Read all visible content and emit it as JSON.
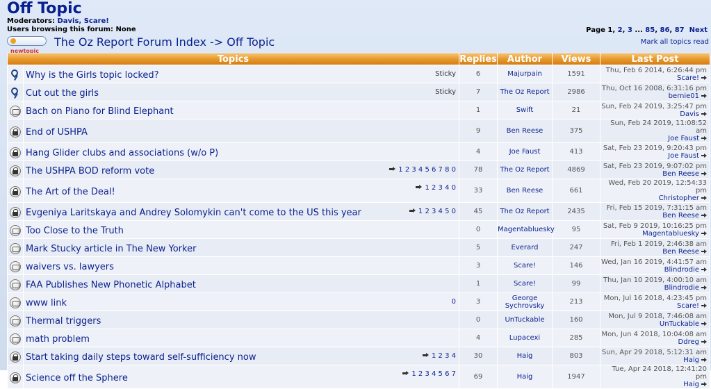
{
  "forum": {
    "title": "Off Topic",
    "moderators_label": "Moderators:",
    "moderators": "Davis, Scare!",
    "browsing": "Users browsing this forum: None",
    "new_topic_label": "newtopic",
    "breadcrumb": "The Oz Report Forum Index -> Off Topic"
  },
  "pagination": {
    "label": "Page",
    "current": "1",
    "sep1": ",",
    "p2": "2",
    "sep2": ",",
    "p3": "3",
    "ellipsis": "...",
    "p85": "85",
    "sep3": ",",
    "p86": "86",
    "sep4": ",",
    "p87": "87",
    "next": "Next",
    "mark_all": "Mark all topics read"
  },
  "columns": {
    "topics": "Topics",
    "replies": "Replies",
    "author": "Author",
    "views": "Views",
    "last_post": "Last Post"
  },
  "topics": [
    {
      "icon": "pin-icon",
      "title": "Why is the Girls topic locked?",
      "tag": "Sticky",
      "pages": "",
      "replies": "6",
      "author": "Majurpain",
      "views": "1591",
      "last_date": "Thu, Feb 6 2014, 6:26:44 pm",
      "last_user": "Scare!"
    },
    {
      "icon": "pin-icon",
      "title": "Cut out the girls",
      "tag": "Sticky",
      "pages": "",
      "replies": "7",
      "author": "The Oz Report",
      "views": "2986",
      "last_date": "Thu, Oct 16 2008, 6:31:16 pm",
      "last_user": "bernie01"
    },
    {
      "icon": "topic-icon",
      "title": "Bach on Piano for Blind Elephant",
      "tag": "",
      "pages": "",
      "replies": "1",
      "author": "Swift",
      "views": "21",
      "last_date": "Sun, Feb 24 2019, 3:25:47 pm",
      "last_user": "Davis"
    },
    {
      "icon": "lock-icon",
      "title": "End of USHPA",
      "tag": "",
      "pages": "",
      "replies": "9",
      "author": "Ben Reese",
      "views": "375",
      "last_date": "Sun, Feb 24 2019, 11:08:52 am",
      "last_user": "Joe Faust"
    },
    {
      "icon": "lock-icon",
      "title": "Hang Glider clubs and associations (w/o P)",
      "tag": "",
      "pages": "",
      "replies": "4",
      "author": "Joe Faust",
      "views": "413",
      "last_date": "Sat, Feb 23 2019, 9:20:43 pm",
      "last_user": "Joe Faust"
    },
    {
      "icon": "lock-icon",
      "title": "The USHPA BOD reform vote",
      "tag": "",
      "pages": "1 2 3 4 5 6 7 8 0",
      "replies": "78",
      "author": "The Oz Report",
      "views": "4869",
      "last_date": "Sat, Feb 23 2019, 9:07:02 pm",
      "last_user": "Ben Reese"
    },
    {
      "icon": "lock-icon",
      "title": "The Art of the Deal!",
      "tag": "",
      "pages": "1 2 3 4 0",
      "replies": "33",
      "author": "Ben Reese",
      "views": "661",
      "last_date": "Wed, Feb 20 2019, 12:54:33 pm",
      "last_user": "Christopher"
    },
    {
      "icon": "lock-icon",
      "title": "Evgeniya Laritskaya and Andrey Solomykin can't come to the US this year",
      "tag": "",
      "pages": "1 2 3 4 5 0",
      "replies": "45",
      "author": "The Oz Report",
      "views": "2435",
      "last_date": "Fri, Feb 15 2019, 7:31:15 am",
      "last_user": "Ben Reese"
    },
    {
      "icon": "topic-icon",
      "title": "Too Close to the Truth",
      "tag": "",
      "pages": "",
      "replies": "0",
      "author": "Magentabluesky",
      "views": "95",
      "last_date": "Sat, Feb 9 2019, 10:16:25 pm",
      "last_user": "Magentabluesky"
    },
    {
      "icon": "topic-icon",
      "title": "Mark Stucky article in The New Yorker",
      "tag": "",
      "pages": "",
      "replies": "5",
      "author": "Everard",
      "views": "247",
      "last_date": "Fri, Feb 1 2019, 2:46:38 am",
      "last_user": "Ben Reese"
    },
    {
      "icon": "topic-icon",
      "title": "waivers vs. lawyers",
      "tag": "",
      "pages": "",
      "replies": "3",
      "author": "Scare!",
      "views": "146",
      "last_date": "Wed, Jan 16 2019, 4:41:57 am",
      "last_user": "Blindrodie"
    },
    {
      "icon": "topic-icon",
      "title": "FAA Publishes New Phonetic Alphabet",
      "tag": "",
      "pages": "",
      "replies": "1",
      "author": "Scare!",
      "views": "99",
      "last_date": "Thu, Jan 10 2019, 4:00:10 am",
      "last_user": "Blindrodie"
    },
    {
      "icon": "topic-icon",
      "title": "www link",
      "tag": "",
      "pages": "0",
      "replies": "3",
      "author": "George Sychrovsky",
      "views": "213",
      "last_date": "Mon, Jul 16 2018, 4:23:45 pm",
      "last_user": "Scare!"
    },
    {
      "icon": "topic-icon",
      "title": "Thermal triggers",
      "tag": "",
      "pages": "",
      "replies": "0",
      "author": "UnTuckable",
      "views": "160",
      "last_date": "Mon, Jul 9 2018, 7:46:08 am",
      "last_user": "UnTuckable"
    },
    {
      "icon": "topic-icon",
      "title": "math problem",
      "tag": "",
      "pages": "",
      "replies": "4",
      "author": "Lupacexi",
      "views": "285",
      "last_date": "Mon, Jun 4 2018, 10:04:08 am",
      "last_user": "Ddreg"
    },
    {
      "icon": "lock-icon",
      "title": "Start taking daily steps toward self-sufficiency now",
      "tag": "",
      "pages": "1 2 3 4",
      "replies": "30",
      "author": "Haig",
      "views": "803",
      "last_date": "Sun, Apr 29 2018, 5:12:31 am",
      "last_user": "Haig"
    },
    {
      "icon": "lock-icon",
      "title": "Science off the Sphere",
      "tag": "",
      "pages": "1 2 3 4 5 6 7",
      "replies": "69",
      "author": "Haig",
      "views": "1947",
      "last_date": "Tue, Apr 24 2018, 12:41:20 pm",
      "last_user": "Haig"
    }
  ],
  "colors": {
    "link": "#0a1f8f",
    "header_orange": "#e89a2f",
    "row_bg": "#eef2f8",
    "row_alt_bg": "#e8edf5"
  }
}
